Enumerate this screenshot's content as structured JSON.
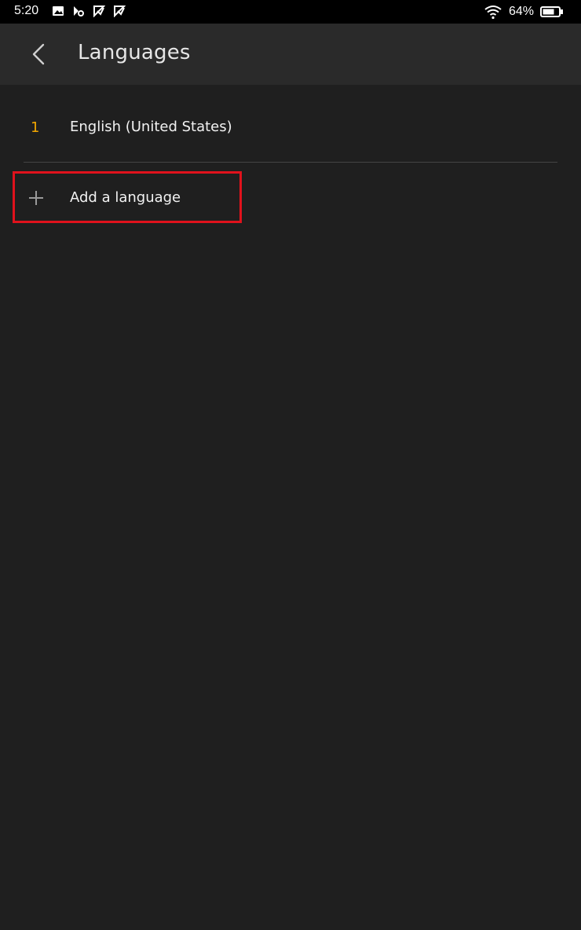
{
  "status_bar": {
    "time": "5:20",
    "battery": "64%",
    "icons": [
      "image-icon",
      "notification-icon",
      "notification-icon",
      "notification-icon",
      "wifi-icon",
      "battery-icon"
    ]
  },
  "header": {
    "title": "Languages",
    "back_icon": "chevron-left-icon"
  },
  "languages": [
    {
      "index": "1",
      "label": "English (United States)"
    }
  ],
  "add_language": {
    "label": "Add a language",
    "icon": "plus-icon"
  },
  "colors": {
    "background": "#1f1f1f",
    "app_bar": "#2a2a2a",
    "accent": "#f0a500",
    "highlight_border": "#e0121c"
  }
}
